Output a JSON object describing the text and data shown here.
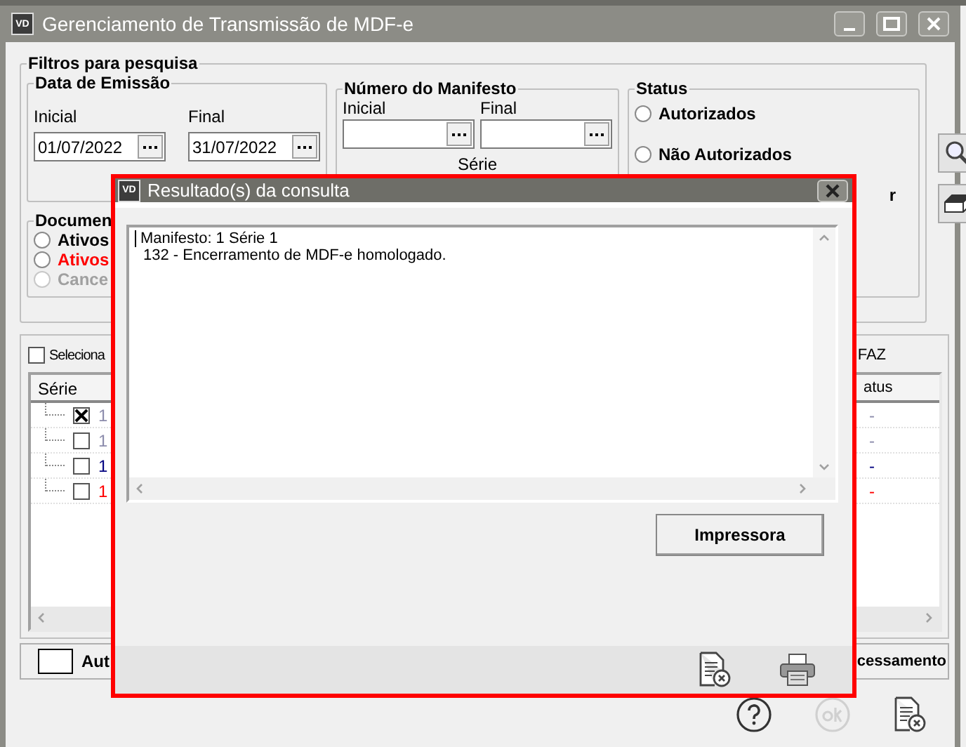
{
  "window": {
    "logo": "VD",
    "title": "Gerenciamento de Transmissão de MDF-e"
  },
  "filters": {
    "title": "Filtros para pesquisa",
    "emission_date": {
      "title": "Data de Emissão",
      "start": {
        "label": "Inicial",
        "value": "01/07/2022"
      },
      "end": {
        "label": "Final",
        "value": "31/07/2022"
      }
    },
    "manifest_number": {
      "title": "Número do Manifesto",
      "start": {
        "label": "Inicial"
      },
      "end": {
        "label": "Final"
      },
      "series_label": "Série"
    },
    "status": {
      "title": "Status",
      "options": [
        {
          "label": "Autorizados",
          "selected": false
        },
        {
          "label": "Não Autorizados",
          "selected": false
        }
      ],
      "cut_text": "r"
    },
    "documents": {
      "title": "Documen",
      "options": [
        {
          "label": "Ativos",
          "kind": "normal",
          "selected": false
        },
        {
          "label": "Ativos",
          "kind": "alert",
          "selected": false
        },
        {
          "label": "Cance",
          "kind": "disabled",
          "selected": false
        }
      ]
    }
  },
  "grid": {
    "select_all": {
      "label": "Seleciona",
      "checked": false
    },
    "right_label": "FAZ",
    "columns": [
      "Série",
      "atus"
    ],
    "rows": [
      {
        "checked": true,
        "series": "1",
        "status": "-",
        "color": "#8c8cac"
      },
      {
        "checked": false,
        "series": "1",
        "status": "-",
        "color": "#8c8cac"
      },
      {
        "checked": false,
        "series": "1",
        "status": "-",
        "color": "#000080"
      },
      {
        "checked": false,
        "series": "1",
        "status": "-",
        "color": "#ff0000"
      }
    ]
  },
  "bottom_bar": {
    "legend_label": "Aut",
    "right_text": "cessamento"
  },
  "dialog": {
    "logo": "VD",
    "title": "Resultado(s) da consulta",
    "lines": [
      "Manifesto: 1 Série 1",
      "132 - Encerramento de MDF-e homologado."
    ],
    "button": "Impressora"
  }
}
